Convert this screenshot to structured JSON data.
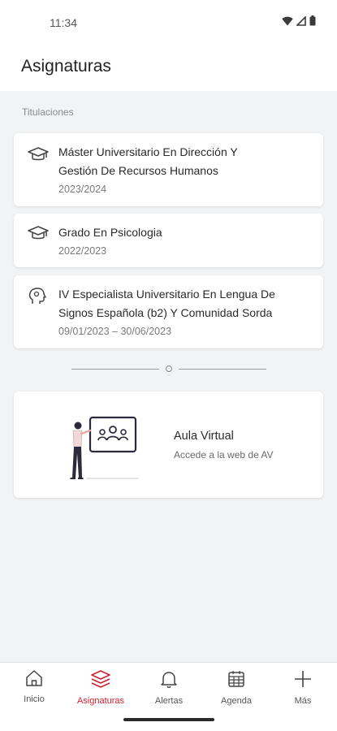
{
  "status": {
    "time": "11:34"
  },
  "header": {
    "title": "Asignaturas"
  },
  "section": {
    "label": "Titulaciones"
  },
  "degrees": [
    {
      "title_line1": "Máster Universitario En Dirección Y",
      "title_line2": "Gestión De Recursos Humanos",
      "period": "2023/2024",
      "icon": "graduation-cap-icon"
    },
    {
      "title_line1": "Grado En Psicologia",
      "period": "2022/2023",
      "icon": "graduation-cap-icon"
    },
    {
      "title_line1": "IV Especialista Universitario En Lengua De",
      "title_line2": "Signos Española (b2) Y Comunidad Sorda",
      "period": "09/01/2023 – 30/06/2023",
      "icon": "head-icon"
    }
  ],
  "aula_virtual": {
    "title": "Aula Virtual",
    "subtitle": "Accede a la web de AV"
  },
  "nav": {
    "items": [
      {
        "label": "Inicio",
        "icon": "home-icon"
      },
      {
        "label": "Asignaturas",
        "icon": "layers-icon",
        "active": true
      },
      {
        "label": "Alertas",
        "icon": "bell-icon"
      },
      {
        "label": "Agenda",
        "icon": "calendar-icon"
      },
      {
        "label": "Más",
        "icon": "plus-icon"
      }
    ]
  },
  "colors": {
    "accent": "#d0202f",
    "background": "#f2f3f5",
    "card": "#ffffff"
  }
}
